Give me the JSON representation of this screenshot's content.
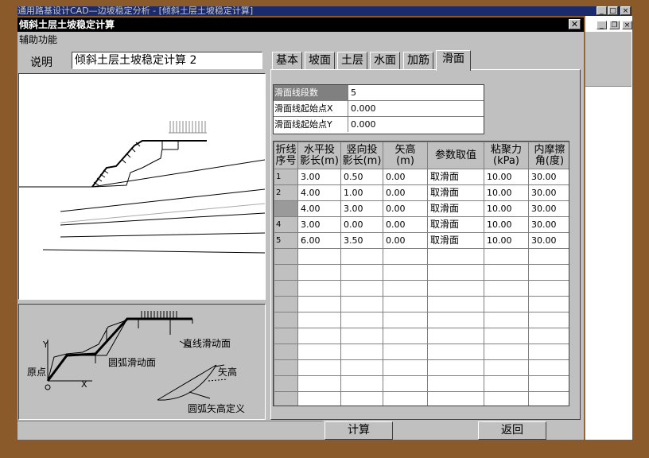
{
  "app": {
    "title": "通用路基设计CAD—边坡稳定分析 - [倾斜土层土坡稳定计算]"
  },
  "dialog": {
    "title": "倾斜土层土坡稳定计算",
    "menu": "辅助功能",
    "close_glyph": "✕",
    "description_label": "说明",
    "description_value": "倾斜土层土坡稳定计算 2"
  },
  "tabs": [
    {
      "label": "基本"
    },
    {
      "label": "坡面"
    },
    {
      "label": "土层"
    },
    {
      "label": "水面"
    },
    {
      "label": "加筋"
    },
    {
      "label": "滑面",
      "active": true
    }
  ],
  "slip_params": [
    {
      "label": "滑面线段数",
      "value": "5"
    },
    {
      "label": "滑面线起始点X",
      "value": "0.000"
    },
    {
      "label": "滑面线起始点Y",
      "value": "0.000"
    }
  ],
  "segments": {
    "headers": [
      "折线\n序号",
      "水平投\n影长(m)",
      "竖向投\n影长(m)",
      "矢高\n(m)",
      "参数取值",
      "粘聚力\n(kPa)",
      "内摩擦\n角(度)"
    ],
    "rows": [
      {
        "no": "1",
        "h": "3.00",
        "v": "0.50",
        "arc": "0.00",
        "param": "取滑面",
        "c": "10.00",
        "phi": "30.00"
      },
      {
        "no": "2",
        "h": "4.00",
        "v": "1.00",
        "arc": "0.00",
        "param": "取滑面",
        "c": "10.00",
        "phi": "30.00"
      },
      {
        "no": "",
        "h": "4.00",
        "v": "3.00",
        "arc": "0.00",
        "param": "取滑面",
        "c": "10.00",
        "phi": "30.00"
      },
      {
        "no": "4",
        "h": "3.00",
        "v": "0.00",
        "arc": "0.00",
        "param": "取滑面",
        "c": "10.00",
        "phi": "30.00"
      },
      {
        "no": "5",
        "h": "6.00",
        "v": "3.50",
        "arc": "0.00",
        "param": "取滑面",
        "c": "10.00",
        "phi": "30.00"
      }
    ],
    "empty_rows": 10
  },
  "legend": {
    "y_axis": "Y",
    "x_axis": "X",
    "origin": "原点",
    "straight_slip": "直线滑动面",
    "arc_slip": "圆弧滑动面",
    "sag": "矢高",
    "arc_sag_def": "圆弧矢高定义"
  },
  "buttons": {
    "calculate": "计算",
    "back": "返回"
  },
  "colors": {
    "window_face": "#c0c0c0",
    "desktop": "#8b5a2b",
    "title_active": "#000000"
  }
}
